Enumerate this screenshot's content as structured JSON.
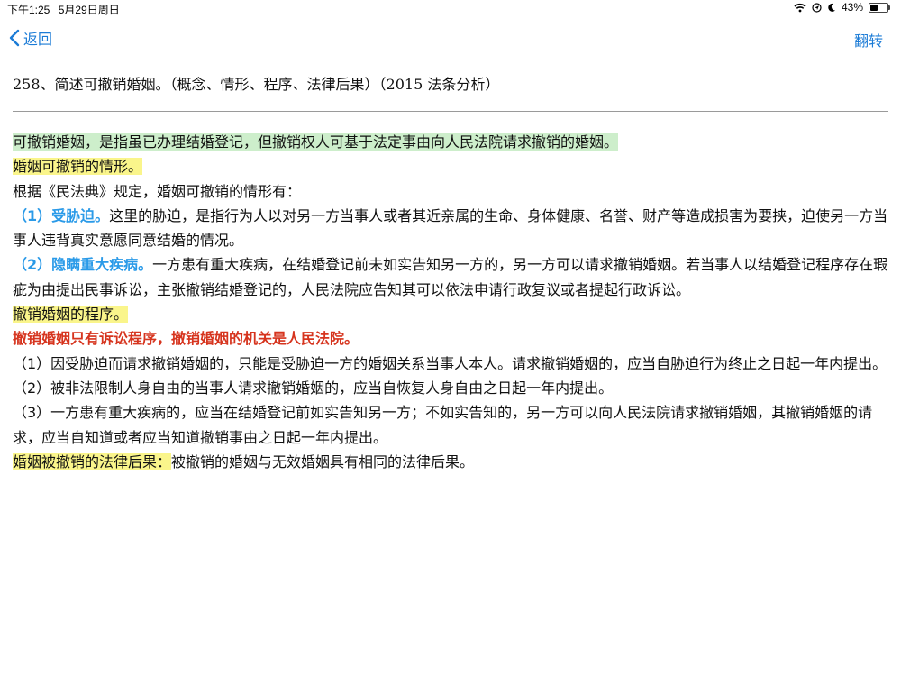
{
  "status_bar": {
    "time": "下午1:25",
    "date": "5月29日周日",
    "battery_percent": "43%",
    "battery_level": 0.43,
    "icons": [
      "wifi-icon",
      "location-icon",
      "moon-icon",
      "battery-icon"
    ]
  },
  "nav": {
    "back_label": "返回",
    "flip_label": "翻转",
    "accent_color": "#1b7bd6"
  },
  "question": "258、简述可撤销婚姻。（概念、情形、程序、法律后果）（2015 法条分析）",
  "answer": {
    "definition": "可撤销婚姻，是指虽已办理结婚登记，但撤销权人可基于法定事由向人民法院请求撤销的婚姻。",
    "situations_heading": "婚姻可撤销的情形。",
    "situations_intro": "根据《民法典》规定，婚姻可撤销的情形有：",
    "situations": [
      {
        "label": "（1）受胁迫。",
        "text": "这里的胁迫，是指行为人以对另一方当事人或者其近亲属的生命、身体健康、名誉、财产等造成损害为要挟，迫使另一方当事人违背真实意愿同意结婚的情况。"
      },
      {
        "label": "（2）隐瞒重大疾病。",
        "text": "一方患有重大疾病，在结婚登记前未如实告知另一方的，另一方可以请求撤销婚姻。若当事人以结婚登记程序存在瑕疵为由提出民事诉讼，主张撤销结婚登记的，人民法院应告知其可以依法申请行政复议或者提起行政诉讼。"
      }
    ],
    "procedure_heading": "撤销婚姻的程序。",
    "procedure_note": "撤销婚姻只有诉讼程序，撤销婚姻的机关是人民法院。",
    "procedure_items": [
      "（1）因受胁迫而请求撤销婚姻的，只能是受胁迫一方的婚姻关系当事人本人。请求撤销婚姻的，应当自胁迫行为终止之日起一年内提出。",
      "（2）被非法限制人身自由的当事人请求撤销婚姻的，应当自恢复人身自由之日起一年内提出。",
      "（3）一方患有重大疾病的，应当在结婚登记前如实告知另一方；不如实告知的，另一方可以向人民法院请求撤销婚姻，其撤销婚姻的请求，应当自知道或者应当知道撤销事由之日起一年内提出。"
    ],
    "consequence_heading": "婚姻被撤销的法律后果：",
    "consequence_text": "被撤销的婚姻与无效婚姻具有相同的法律后果。"
  },
  "colors": {
    "highlight_green": "#cdeecb",
    "highlight_yellow": "#faf58b",
    "label_blue": "#2a9ae8",
    "note_red": "#d6341e"
  }
}
